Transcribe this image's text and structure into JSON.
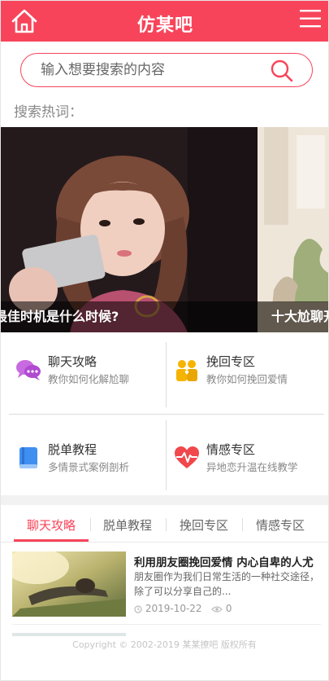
{
  "header": {
    "title": "仿某吧"
  },
  "search": {
    "placeholder": "输入想要搜索的内容"
  },
  "hot": {
    "label": "搜索热词："
  },
  "banner": {
    "slides": [
      {
        "caption": "友的最佳时机是什么时候?"
      },
      {
        "caption": "十大尬聊开"
      }
    ]
  },
  "categories": [
    {
      "title": "聊天攻略",
      "subtitle": "教你如何化解尬聊",
      "icon": "chat-bubbles-icon",
      "color": "#c86ae0"
    },
    {
      "title": "挽回专区",
      "subtitle": "教你如何挽回爱情",
      "icon": "couple-icon",
      "color": "#f5b400"
    },
    {
      "title": "脱单教程",
      "subtitle": "多情景式案例剖析",
      "icon": "book-icon",
      "color": "#3f8ff0"
    },
    {
      "title": "情感专区",
      "subtitle": "异地恋升温在线教学",
      "icon": "heartbeat-icon",
      "color": "#f0484c"
    }
  ],
  "tabs": [
    {
      "label": "聊天攻略",
      "active": true
    },
    {
      "label": "脱单教程",
      "active": false
    },
    {
      "label": "挽回专区",
      "active": false
    },
    {
      "label": "情感专区",
      "active": false
    }
  ],
  "articles": [
    {
      "title": "利用朋友圈挽回爱情 内心自卑的人尤",
      "description": "朋友圈作为我们日常生活的一种社交途径，除了可以分享自己的...",
      "date": "2019-10-22",
      "views": "0"
    }
  ],
  "footer": {
    "copyright": "Copyright © 2002-2019 某某撩吧 版权所有"
  },
  "colors": {
    "accent": "#f8445a"
  }
}
